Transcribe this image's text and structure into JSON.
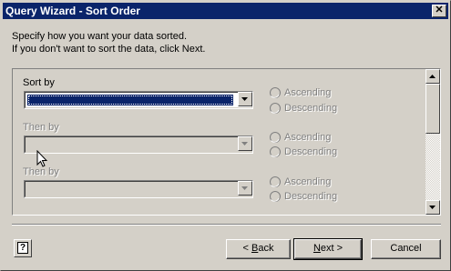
{
  "window": {
    "title": "Query Wizard - Sort Order"
  },
  "title_buttons": {
    "close_glyph": "✕"
  },
  "intro": {
    "line1": "Specify how you want your data sorted.",
    "line2": "If you don't want to sort the data, click Next."
  },
  "sort_rows": [
    {
      "label": "Sort by",
      "value": "",
      "enabled": true,
      "ascending": "Ascending",
      "descending": "Descending",
      "order_enabled": false
    },
    {
      "label": "Then by",
      "value": "",
      "enabled": false,
      "ascending": "Ascending",
      "descending": "Descending",
      "order_enabled": false
    },
    {
      "label": "Then by",
      "value": "",
      "enabled": false,
      "ascending": "Ascending",
      "descending": "Descending",
      "order_enabled": false
    }
  ],
  "buttons": {
    "help_glyph": "?",
    "back_prefix": "< ",
    "back_key": "B",
    "back_rest": "ack",
    "next_key": "N",
    "next_rest": "ext >",
    "cancel": "Cancel"
  },
  "colors": {
    "title_bar": "#0a246a",
    "face": "#d4d0c8",
    "selection": "#0a246a"
  },
  "icons": [
    "close-icon",
    "help-icon",
    "dropdown-arrow-icon",
    "scroll-up-icon",
    "scroll-down-icon",
    "mouse-cursor-icon"
  ]
}
